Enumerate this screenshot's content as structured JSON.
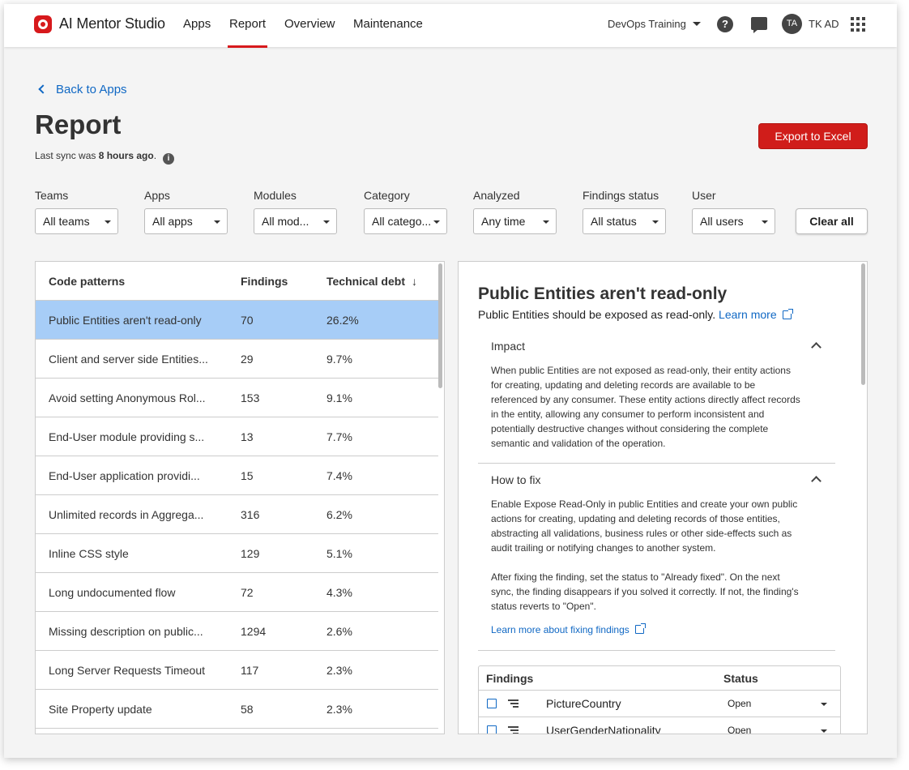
{
  "nav": {
    "brand": "AI Mentor Studio",
    "links": [
      "Apps",
      "Report",
      "Overview",
      "Maintenance"
    ],
    "active": "Report",
    "tenant": "DevOps Training",
    "avatar_initials": "TA",
    "username": "TK AD"
  },
  "page": {
    "back_label": "Back to Apps",
    "title": "Report",
    "sync_prefix": "Last sync was ",
    "sync_time": "8 hours ago",
    "sync_suffix": ".",
    "export_label": "Export to Excel",
    "clear_label": "Clear all"
  },
  "filters": [
    {
      "label": "Teams",
      "value": "All teams"
    },
    {
      "label": "Apps",
      "value": "All apps"
    },
    {
      "label": "Modules",
      "value": "All mod..."
    },
    {
      "label": "Category",
      "value": "All catego..."
    },
    {
      "label": "Analyzed",
      "value": "Any time"
    },
    {
      "label": "Findings status",
      "value": "All status"
    },
    {
      "label": "User",
      "value": "All users"
    }
  ],
  "table": {
    "columns": [
      "Code patterns",
      "Findings",
      "Technical debt"
    ],
    "sort_icon": "↓",
    "rows": [
      {
        "pattern": "Public Entities aren't read-only",
        "findings": "70",
        "debt": "26.2%"
      },
      {
        "pattern": "Client and server side Entities...",
        "findings": "29",
        "debt": "9.7%"
      },
      {
        "pattern": "Avoid setting Anonymous Rol...",
        "findings": "153",
        "debt": "9.1%"
      },
      {
        "pattern": "End-User module providing s...",
        "findings": "13",
        "debt": "7.7%"
      },
      {
        "pattern": "End-User application providi...",
        "findings": "15",
        "debt": "7.4%"
      },
      {
        "pattern": "Unlimited records in Aggrega...",
        "findings": "316",
        "debt": "6.2%"
      },
      {
        "pattern": "Inline CSS style",
        "findings": "129",
        "debt": "5.1%"
      },
      {
        "pattern": "Long undocumented flow",
        "findings": "72",
        "debt": "4.3%"
      },
      {
        "pattern": "Missing description on public...",
        "findings": "1294",
        "debt": "2.6%"
      },
      {
        "pattern": "Long Server Requests Timeout",
        "findings": "117",
        "debt": "2.3%"
      },
      {
        "pattern": "Site Property update",
        "findings": "58",
        "debt": "2.3%"
      }
    ]
  },
  "detail": {
    "title": "Public Entities aren't read-only",
    "subtitle": "Public Entities should be exposed as read-only.",
    "learn_more": "Learn more",
    "impact_heading": "Impact",
    "impact_lines": [
      "When public Entities are not exposed as read-only, their entity actions",
      "for creating, updating and deleting records are available to be",
      "referenced by any consumer. These entity actions directly affect records",
      "in the entity, allowing any consumer to perform inconsistent and",
      "potentially destructive changes without considering the complete",
      "semantic and validation of the operation."
    ],
    "howto_heading": "How to fix",
    "howto_lines": [
      "Enable Expose Read-Only in public Entities and create your own public",
      "actions for creating, updating and deleting records of those entities,",
      "abstracting all validations, business rules or other side-effects such as",
      "audit trailing or notifying changes to another system."
    ],
    "howto_lines2": [
      "After fixing the finding, set the status to \"Already fixed\". On the next",
      "sync, the finding disappears if you solved it correctly. If not, the finding's",
      "status reverts to \"Open\"."
    ],
    "fix_link": "Learn more about fixing findings",
    "findings_header": [
      "Findings",
      "Status"
    ],
    "findings": [
      {
        "name": "PictureCountry",
        "status": "Open"
      },
      {
        "name": "UserGenderNationality",
        "status": "Open"
      }
    ]
  }
}
